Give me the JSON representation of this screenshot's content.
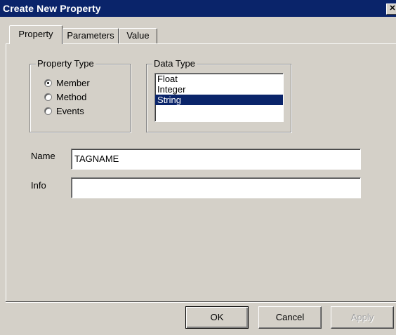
{
  "window": {
    "title": "Create New Property",
    "close_glyph": "✕"
  },
  "tabs": [
    {
      "label": "Property",
      "active": true
    },
    {
      "label": "Parameters",
      "active": false
    },
    {
      "label": "Value",
      "active": false
    }
  ],
  "property_type": {
    "label": "Property Type",
    "options": [
      {
        "label": "Member",
        "checked": true
      },
      {
        "label": "Method",
        "checked": false
      },
      {
        "label": "Events",
        "checked": false
      }
    ]
  },
  "data_type": {
    "label": "Data Type",
    "items": [
      "Float",
      "Integer",
      "String"
    ],
    "selected_index": 2
  },
  "fields": {
    "name_label": "Name",
    "name_value": "TAGNAME",
    "info_label": "Info",
    "info_value": ""
  },
  "buttons": {
    "ok": "OK",
    "cancel": "Cancel",
    "apply": "Apply",
    "apply_enabled": false
  },
  "colors": {
    "titlebar": "#0a246a",
    "face": "#d4d0c8",
    "selection": "#0a246a"
  }
}
